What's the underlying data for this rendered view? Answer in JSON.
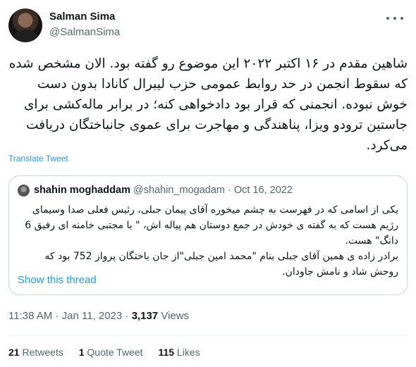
{
  "author": {
    "name": "Salman Sima",
    "handle": "@SalmanSima"
  },
  "tweet": {
    "text": "شاهین مقدم در ۱۶ اکتبر ۲۰۲۲ این موضوع رو گفته بود. الان مشخص شده که سقوط انجمن در حد روابط عمومی حزب لیبرال کانادا بدون دست خوش نبوده. انجمنی که قرار بود دادخواهی کنه؛ در برابر ماله‌کشی برای جاستین ترودو ویزا، پناهندگی و مهاجرت برای عموی جانباختگان دریافت می‌کرد.",
    "translate_label": "Translate Tweet"
  },
  "quoted": {
    "name": "shahin moghaddam",
    "handle": "@shahin_mogadam",
    "separator": "·",
    "date": "Oct 16, 2022",
    "paragraph1": "یکی از اسامی که در فهرست به چشم میخوره آقای پیمان جبلی، رئیس فعلی صدا وسیمای رژیم هست که به گفته ی خودش در جمع دوستان هم پیاله اش، \" با مجتبی خامنه ای رفیق 6 دانگ\" هست.",
    "paragraph2": "برادر زاده ی همین آقای جبلی بنام \"محمد امین جبلی\"از جان باختگان پرواز 752 بود که روحش شاد و نامش جاودان.",
    "show_thread_label": "Show this thread"
  },
  "meta": {
    "time": "11:38 AM",
    "separator": "·",
    "date": "Jan 11, 2023",
    "views_count": "3,137",
    "views_label": "Views"
  },
  "stats": {
    "retweets_count": "21",
    "retweets_label": "Retweets",
    "quotes_count": "1",
    "quotes_label": "Quote Tweet",
    "likes_count": "115",
    "likes_label": "Likes"
  }
}
